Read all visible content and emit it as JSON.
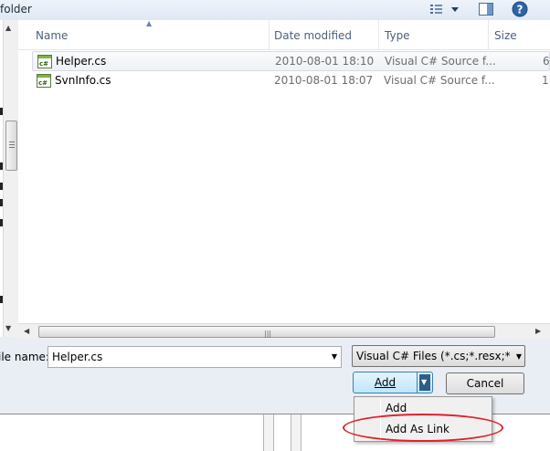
{
  "dialog": {
    "title_fragment": "folder",
    "toolbar": {
      "views_icon": "views-icon",
      "preview_icon": "preview-pane-icon",
      "help_icon": "help-icon"
    }
  },
  "filelist": {
    "columns": {
      "name": "Name",
      "date": "Date modified",
      "type": "Type",
      "size": "Size"
    },
    "files": [
      {
        "name": "Helper.cs",
        "date": "2010-08-01 18:10",
        "type": "Visual C# Source f...",
        "size": "6",
        "selected": true,
        "icon": "csharp-file-icon"
      },
      {
        "name": "SvnInfo.cs",
        "date": "2010-08-01 18:07",
        "type": "Visual C# Source f...",
        "size": "1",
        "selected": false,
        "icon": "csharp-file-icon"
      }
    ]
  },
  "bottom": {
    "filename_label": "ile name:",
    "filename_value": "Helper.cs",
    "filter_value": "Visual C# Files (*.cs;*.resx;*.setti",
    "add_label": "Add",
    "cancel_label": "Cancel"
  },
  "add_menu": {
    "items": [
      "Add",
      "Add As Link"
    ],
    "highlighted": "Add As Link",
    "highlight_color": "#e0212b"
  }
}
